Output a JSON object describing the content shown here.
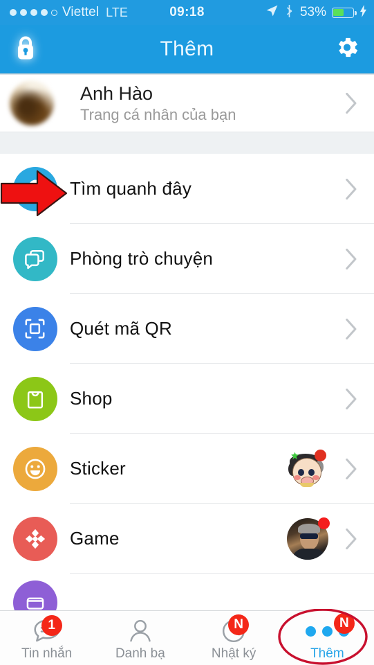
{
  "status_bar": {
    "signal_dots": 5,
    "signal_filled": 4,
    "carrier": "Viettel",
    "network": "LTE",
    "time": "09:18",
    "location_icon": "location-arrow-icon",
    "bluetooth_icon": "bluetooth-icon",
    "battery_percent": "53%",
    "battery_level": 53,
    "charging_icon": "lightning-bolt-icon"
  },
  "nav_bar": {
    "lock_icon": "lock-icon",
    "title": "Thêm",
    "settings_icon": "gear-icon"
  },
  "profile": {
    "name": "Anh Hào",
    "subtitle": "Trang cá nhân của bạn",
    "avatar": "user-avatar",
    "chevron": "chevron-right-icon"
  },
  "menu": {
    "items": [
      {
        "label": "Tìm quanh đây",
        "icon": "location-pin-icon",
        "color": "#29A8E0",
        "badge": null,
        "thumb": null
      },
      {
        "label": "Phòng trò chuyện",
        "icon": "chat-bubbles-icon",
        "color": "#32B8C6",
        "badge": null,
        "thumb": null
      },
      {
        "label": "Quét mã QR",
        "icon": "qr-scan-icon",
        "color": "#3B82E8",
        "badge": null,
        "thumb": null
      },
      {
        "label": "Shop",
        "icon": "shopping-bag-icon",
        "color": "#8CC717",
        "badge": null,
        "thumb": null
      },
      {
        "label": "Sticker",
        "icon": "smiley-icon",
        "color": "#ECA93C",
        "badge": "red-dot",
        "thumb": "sticker-character-thumbnail"
      },
      {
        "label": "Game",
        "icon": "dpad-icon",
        "color": "#E85C56",
        "badge": "red-dot",
        "thumb": "game-avatar-thumbnail"
      },
      {
        "label": "",
        "icon": "wallet-icon",
        "color": "#8E5FD6",
        "badge": null,
        "thumb": null
      }
    ]
  },
  "tab_bar": {
    "tabs": [
      {
        "label": "Tin nhắn",
        "icon": "message-bubble-icon",
        "badge": "1",
        "active": false
      },
      {
        "label": "Danh bạ",
        "icon": "contacts-person-icon",
        "badge": "",
        "active": false
      },
      {
        "label": "Nhật ký",
        "icon": "clock-history-icon",
        "badge": "N",
        "active": false
      },
      {
        "label": "Thêm",
        "icon": "three-dots-icon",
        "badge": "N",
        "active": true
      }
    ]
  },
  "annotations": {
    "arrow_color": "#EE1111",
    "ellipse_color": "#C8102E",
    "arrow_target": "Tìm quanh đây",
    "ellipse_target": "Thêm"
  },
  "colors": {
    "header_blue": "#1C9BE0",
    "status_blue": "#219BE0",
    "active_tab_blue": "#2AA5E8",
    "badge_red": "#F42718"
  }
}
